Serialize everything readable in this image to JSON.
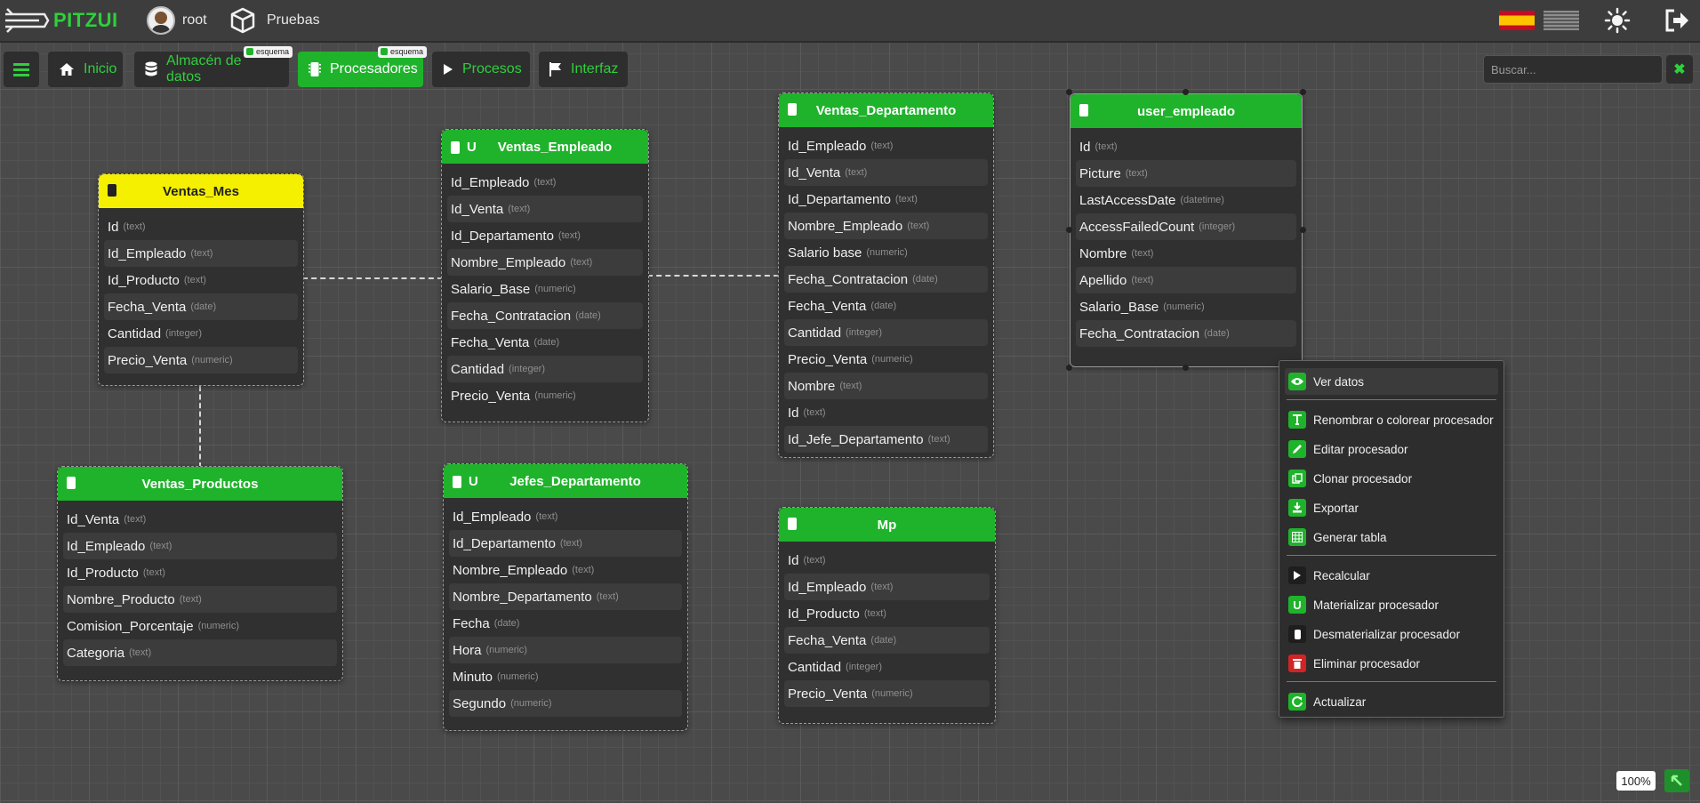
{
  "app": {
    "name": "PITZUI",
    "user": "root",
    "project": "Pruebas"
  },
  "colors": {
    "accent": "#1fb32b",
    "accent_text": "#2fcf3d",
    "highlight_table": "#f5ef00",
    "danger": "#d22424"
  },
  "tabs": [
    {
      "label": "Inicio",
      "icon": "home-icon"
    },
    {
      "label": "Almacén de datos",
      "icon": "database-icon",
      "badge": "esquema"
    },
    {
      "label": "Procesadores",
      "icon": "chip-icon",
      "badge": "esquema",
      "active": true
    },
    {
      "label": "Procesos",
      "icon": "play-icon"
    },
    {
      "label": "Interfaz",
      "icon": "flag-icon"
    }
  ],
  "search": {
    "placeholder": "Buscar...",
    "clear_label": "✖"
  },
  "tables": [
    {
      "name": "Ventas_Mes",
      "fields": [
        {
          "n": "Id",
          "t": "(text)"
        },
        {
          "n": "Id_Empleado",
          "t": "(text)"
        },
        {
          "n": "Id_Producto",
          "t": "(text)"
        },
        {
          "n": "Fecha_Venta",
          "t": "(date)"
        },
        {
          "n": "Cantidad",
          "t": "(integer)"
        },
        {
          "n": "Precio_Venta",
          "t": "(numeric)"
        }
      ]
    },
    {
      "name": "Ventas_Empleado",
      "fields": [
        {
          "n": "Id_Empleado",
          "t": "(text)"
        },
        {
          "n": "Id_Venta",
          "t": "(text)"
        },
        {
          "n": "Id_Departamento",
          "t": "(text)"
        },
        {
          "n": "Nombre_Empleado",
          "t": "(text)"
        },
        {
          "n": "Salario_Base",
          "t": "(numeric)"
        },
        {
          "n": "Fecha_Contratacion",
          "t": "(date)"
        },
        {
          "n": "Fecha_Venta",
          "t": "(date)"
        },
        {
          "n": "Cantidad",
          "t": "(integer)"
        },
        {
          "n": "Precio_Venta",
          "t": "(numeric)"
        }
      ]
    },
    {
      "name": "Ventas_Departamento",
      "fields": [
        {
          "n": "Id_Empleado",
          "t": "(text)"
        },
        {
          "n": "Id_Venta",
          "t": "(text)"
        },
        {
          "n": "Id_Departamento",
          "t": "(text)"
        },
        {
          "n": "Nombre_Empleado",
          "t": "(text)"
        },
        {
          "n": "Salario base",
          "t": "(numeric)"
        },
        {
          "n": "Fecha_Contratacion",
          "t": "(date)"
        },
        {
          "n": "Fecha_Venta",
          "t": "(date)"
        },
        {
          "n": "Cantidad",
          "t": "(integer)"
        },
        {
          "n": "Precio_Venta",
          "t": "(numeric)"
        },
        {
          "n": "Nombre",
          "t": "(text)"
        },
        {
          "n": "Id",
          "t": "(text)"
        },
        {
          "n": "Id_Jefe_Departamento",
          "t": "(text)"
        }
      ]
    },
    {
      "name": "user_empleado",
      "fields": [
        {
          "n": "Id",
          "t": "(text)"
        },
        {
          "n": "Picture",
          "t": "(text)"
        },
        {
          "n": "LastAccessDate",
          "t": "(datetime)"
        },
        {
          "n": "AccessFailedCount",
          "t": "(integer)"
        },
        {
          "n": "Nombre",
          "t": "(text)"
        },
        {
          "n": "Apellido",
          "t": "(text)"
        },
        {
          "n": "Salario_Base",
          "t": "(numeric)"
        },
        {
          "n": "Fecha_Contratacion",
          "t": "(date)"
        }
      ]
    },
    {
      "name": "Ventas_Productos",
      "fields": [
        {
          "n": "Id_Venta",
          "t": "(text)"
        },
        {
          "n": "Id_Empleado",
          "t": "(text)"
        },
        {
          "n": "Id_Producto",
          "t": "(text)"
        },
        {
          "n": "Nombre_Producto",
          "t": "(text)"
        },
        {
          "n": "Comision_Porcentaje",
          "t": "(numeric)"
        },
        {
          "n": "Categoria",
          "t": "(text)"
        }
      ]
    },
    {
      "name": "Jefes_Departamento",
      "fields": [
        {
          "n": "Id_Empleado",
          "t": "(text)"
        },
        {
          "n": "Id_Departamento",
          "t": "(text)"
        },
        {
          "n": "Nombre_Empleado",
          "t": "(text)"
        },
        {
          "n": "Nombre_Departamento",
          "t": "(text)"
        },
        {
          "n": "Fecha",
          "t": "(date)"
        },
        {
          "n": "Hora",
          "t": "(numeric)"
        },
        {
          "n": "Minuto",
          "t": "(numeric)"
        },
        {
          "n": "Segundo",
          "t": "(numeric)"
        }
      ]
    },
    {
      "name": "Mp",
      "fields": [
        {
          "n": "Id",
          "t": "(text)"
        },
        {
          "n": "Id_Empleado",
          "t": "(text)"
        },
        {
          "n": "Id_Producto",
          "t": "(text)"
        },
        {
          "n": "Fecha_Venta",
          "t": "(date)"
        },
        {
          "n": "Cantidad",
          "t": "(integer)"
        },
        {
          "n": "Precio_Venta",
          "t": "(numeric)"
        }
      ]
    }
  ],
  "context_menu": {
    "items": [
      "Ver datos",
      "Renombrar o colorear procesador",
      "Editar procesador",
      "Clonar procesador",
      "Exportar",
      "Generar tabla",
      "Recalcular",
      "Materializar procesador",
      "Desmaterializar procesador",
      "Eliminar procesador",
      "Actualizar"
    ]
  },
  "zoom": "100%"
}
